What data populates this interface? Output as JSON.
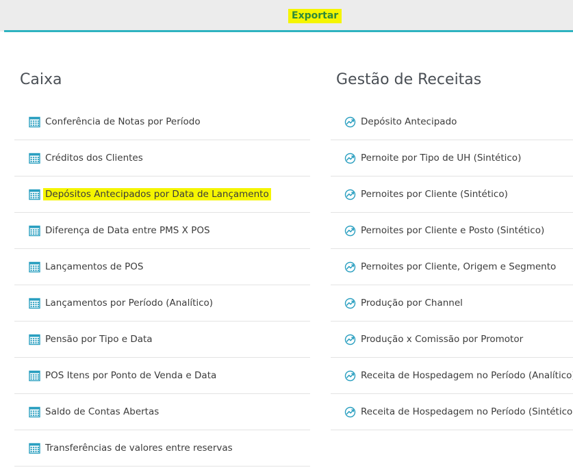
{
  "header": {
    "export_label": "Exportar"
  },
  "sections": {
    "caixa": {
      "title": "Caixa",
      "items": [
        {
          "label": "Conferência de Notas por Período"
        },
        {
          "label": "Créditos dos Clientes"
        },
        {
          "label": "Depósitos Antecipados por Data de Lançamento"
        },
        {
          "label": "Diferença de Data entre PMS X POS"
        },
        {
          "label": "Lançamentos de POS"
        },
        {
          "label": "Lançamentos por Período (Analítico)"
        },
        {
          "label": "Pensão por Tipo e Data"
        },
        {
          "label": "POS Itens por Ponto de Venda e Data"
        },
        {
          "label": "Saldo de Contas Abertas"
        },
        {
          "label": "Transferências de valores entre reservas"
        }
      ]
    },
    "receitas": {
      "title": "Gestão de Receitas",
      "items": [
        {
          "label": "Depósito Antecipado"
        },
        {
          "label": "Pernoite por Tipo de UH (Sintético)"
        },
        {
          "label": "Pernoites por Cliente (Sintético)"
        },
        {
          "label": "Pernoites por Cliente e Posto (Sintético)"
        },
        {
          "label": "Pernoites por Cliente, Origem e Segmento"
        },
        {
          "label": "Produção por Channel"
        },
        {
          "label": "Produção x Comissão por Promotor"
        },
        {
          "label": "Receita de Hospedagem no Período (Analítico)"
        },
        {
          "label": "Receita de Hospedagem no Período (Sintético)"
        }
      ]
    }
  },
  "icons": {
    "caixa_item": "calendar-grid-icon",
    "receitas_item": "trend-chart-icon"
  },
  "colors": {
    "accent": "#2eb3c0",
    "highlight": "#f5f500",
    "export_text": "#2f8a3a",
    "icon": "#2a9fc0"
  }
}
